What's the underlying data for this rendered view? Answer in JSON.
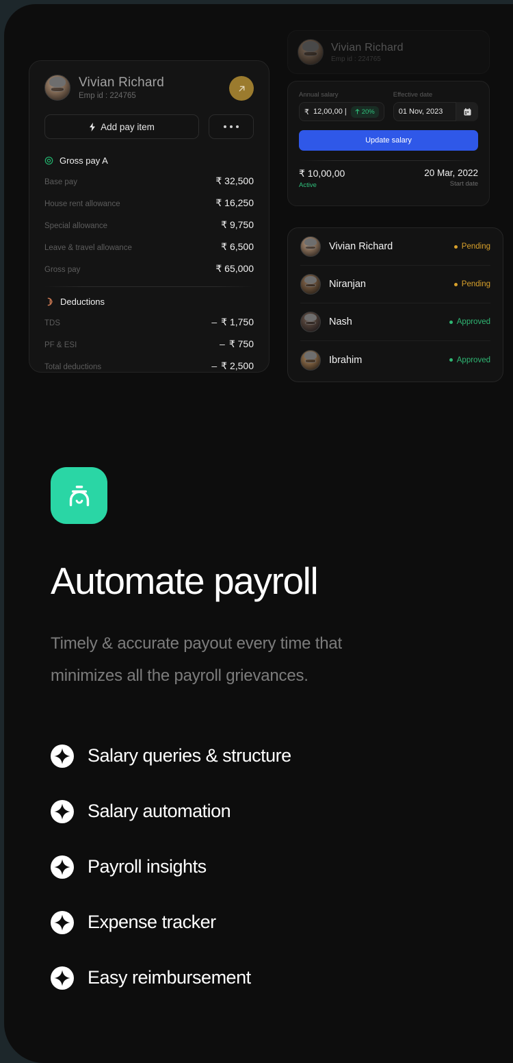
{
  "colors": {
    "page_bg": "#0d0d0d",
    "outer_bg": "#1d272b",
    "accent_green": "#2ad6a5",
    "brand_blue": "#2f58e8",
    "status_pending": "#d9a12b",
    "status_approved": "#2fb673",
    "gold": "#9b7b2e"
  },
  "payslip": {
    "employee": {
      "name": "Vivian Richard",
      "emp_id": "Emp id : 224765",
      "avatar": "employee-avatar"
    },
    "expand_button": "open-arrow-icon",
    "actions": {
      "add_label": "Add pay item",
      "add_icon": "bolt-icon",
      "more_icon": "ellipsis-icon"
    },
    "gross": {
      "title": "Gross pay A",
      "icon": "target-ring-icon",
      "rows": [
        {
          "label": "Base pay",
          "value": "₹ 32,500"
        },
        {
          "label": "House rent allowance",
          "value": "₹ 16,250"
        },
        {
          "label": "Special allowance",
          "value": "₹ 9,750"
        },
        {
          "label": "Leave & travel allowance",
          "value": "₹ 6,500"
        },
        {
          "label": "Gross pay",
          "value": "₹ 65,000"
        }
      ]
    },
    "deductions": {
      "title": "Deductions",
      "icon": "deduction-arc-icon",
      "rows": [
        {
          "label": "TDS",
          "minus": "–",
          "value": "₹ 1,750"
        },
        {
          "label": "PF & ESI",
          "minus": "–",
          "value": "₹ 750"
        },
        {
          "label": "Total deductions",
          "minus": "–",
          "value": "₹ 2,500"
        }
      ]
    }
  },
  "salary_panel": {
    "employee": {
      "name": "Vivian Richard",
      "emp_id": "Emp id : 224765"
    },
    "annual_salary": {
      "label": "Annual salary",
      "currency": "₹",
      "value": "12,00,00 |",
      "change_pct": "20%",
      "change_icon": "arrow-up-icon"
    },
    "effective_date": {
      "label": "Effective date",
      "value": "01 Nov, 2023",
      "calendar_icon": "calendar-icon"
    },
    "update_button": "Update salary",
    "current": {
      "amount": "₹ 10,00,00",
      "status": "Active",
      "date": "20 Mar, 2022",
      "date_caption": "Start date"
    }
  },
  "approvals": [
    {
      "name": "Vivian Richard",
      "status": "Pending",
      "state": "pending"
    },
    {
      "name": "Niranjan",
      "status": "Pending",
      "state": "pending"
    },
    {
      "name": "Nash",
      "status": "Approved",
      "state": "approved"
    },
    {
      "name": "Ibrahim",
      "status": "Approved",
      "state": "approved"
    }
  ],
  "hero": {
    "app_icon": "payroll-app-icon",
    "headline": "Automate payroll",
    "subhead": "Timely & accurate payout every time that minimizes all the payroll grievances.",
    "features": [
      {
        "icon": "sparkle-icon",
        "label": "Salary queries & structure"
      },
      {
        "icon": "sparkle-icon",
        "label": "Salary automation"
      },
      {
        "icon": "sparkle-icon",
        "label": "Payroll insights"
      },
      {
        "icon": "sparkle-icon",
        "label": "Expense tracker"
      },
      {
        "icon": "sparkle-icon",
        "label": "Easy reimbursement"
      }
    ]
  }
}
